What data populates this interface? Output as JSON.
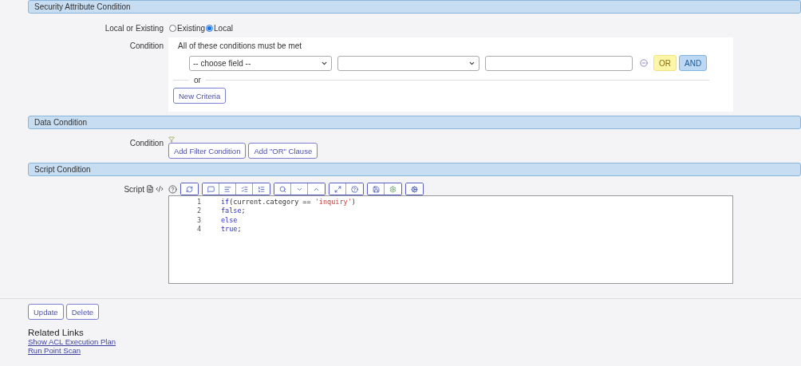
{
  "sections": [
    {
      "kind": "security",
      "title": "Security Attribute Condition",
      "local_or_existing": {
        "label": "Local or Existing",
        "options": [
          {
            "label": "Existing",
            "selected": false
          },
          {
            "label": "Local",
            "selected": true
          }
        ]
      },
      "condition": {
        "label": "Condition",
        "heading": "All of these conditions must be met",
        "field_select": {
          "value": "-- choose field --"
        },
        "or_label": "or",
        "or_button": "OR",
        "and_button": "AND",
        "new_criteria_button": "New Criteria"
      }
    },
    {
      "kind": "data",
      "title": "Data Condition",
      "condition": {
        "label": "Condition",
        "buttons": [
          "Add Filter Condition",
          "Add \"OR\" Clause"
        ]
      }
    },
    {
      "kind": "script",
      "title": "Script Condition",
      "script": {
        "label": "Script",
        "lines": [
          {
            "number": "1",
            "tokens": [
              {
                "kind": "keyword",
                "text": "if"
              },
              {
                "kind": "plain",
                "text": "(current.category == "
              },
              {
                "kind": "string",
                "text": "'inquiry'"
              },
              {
                "kind": "plain",
                "text": ")"
              }
            ]
          },
          {
            "number": "2",
            "tokens": [
              {
                "kind": "keyword",
                "text": "false"
              },
              {
                "kind": "plain",
                "text": ";"
              }
            ]
          },
          {
            "number": "3",
            "tokens": [
              {
                "kind": "keyword",
                "text": "else"
              }
            ]
          },
          {
            "number": "4",
            "tokens": [
              {
                "kind": "keyword",
                "text": "true"
              },
              {
                "kind": "plain",
                "text": ";"
              }
            ]
          }
        ]
      }
    }
  ],
  "actions": [
    "Update",
    "Delete"
  ],
  "related_links": {
    "title": "Related Links",
    "links": [
      "Show ACL Execution Plan",
      "Run Point Scan"
    ]
  }
}
